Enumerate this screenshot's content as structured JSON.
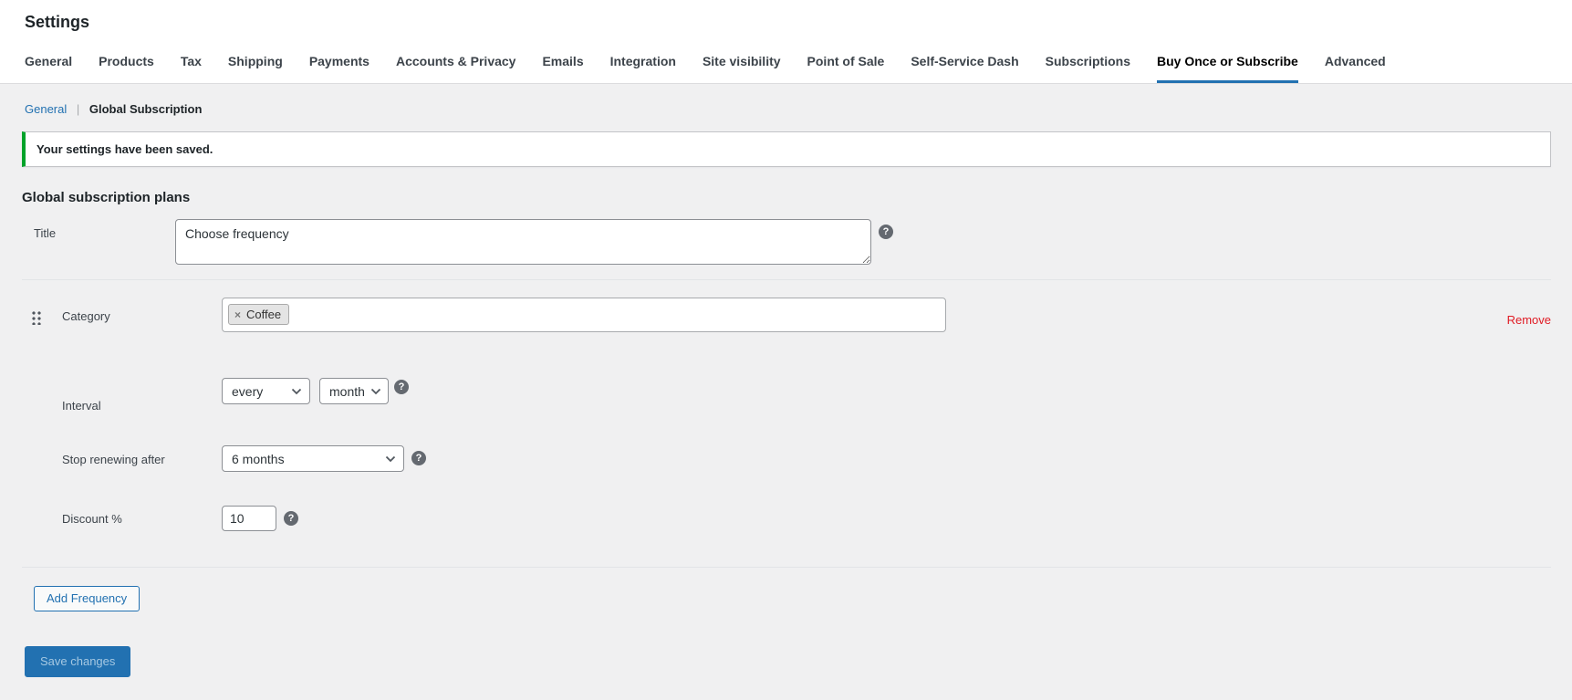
{
  "header": {
    "title": "Settings"
  },
  "tabs": [
    {
      "label": "General"
    },
    {
      "label": "Products"
    },
    {
      "label": "Tax"
    },
    {
      "label": "Shipping"
    },
    {
      "label": "Payments"
    },
    {
      "label": "Accounts & Privacy"
    },
    {
      "label": "Emails"
    },
    {
      "label": "Integration"
    },
    {
      "label": "Site visibility"
    },
    {
      "label": "Point of Sale"
    },
    {
      "label": "Self-Service Dash"
    },
    {
      "label": "Subscriptions"
    },
    {
      "label": "Buy Once or Subscribe",
      "active": true
    },
    {
      "label": "Advanced"
    }
  ],
  "subnav": {
    "general_label": "General",
    "separator": "|",
    "current_label": "Global Subscription"
  },
  "notice": {
    "message": "Your settings have been saved."
  },
  "section_heading": "Global subscription plans",
  "form": {
    "title_row": {
      "label": "Title",
      "value": "Choose frequency"
    },
    "category_row": {
      "label": "Category",
      "tag_label": "Coffee",
      "tag_remove_symbol": "×",
      "remove_link": "Remove"
    },
    "interval_row": {
      "label": "Interval",
      "interval_value": "every",
      "period_value": "month"
    },
    "stop_row": {
      "label": "Stop renewing after",
      "value": "6 months"
    },
    "discount_row": {
      "label": "Discount %",
      "value": "10"
    },
    "help_icon_symbol": "?"
  },
  "actions": {
    "add_frequency": "Add Frequency",
    "save_changes": "Save changes"
  },
  "colors": {
    "accent": "#2271b1",
    "success_green": "#00a32a",
    "remove_red": "#e01b24",
    "page_background": "#f0f0f1"
  }
}
